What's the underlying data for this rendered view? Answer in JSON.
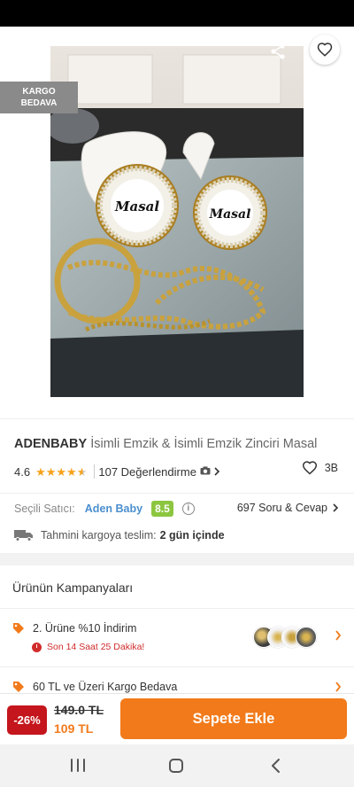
{
  "header": {
    "back_icon": "arrow-left-icon",
    "share_icon": "share-icon",
    "favorite_icon": "heart-outline-icon"
  },
  "badge": {
    "line1": "KARGO",
    "line2": "BEDAVA"
  },
  "product": {
    "image_text_left": "Masal",
    "image_text_right": "Masal",
    "brand": "ADENBABY",
    "name": "İsimli Emzik & İsimli Emzik Zinciri Masal",
    "rating": "4.6",
    "stars": 4.6,
    "review_count": "107 Değerlendirme",
    "camera_icon": "camera-icon",
    "likes": "3B"
  },
  "seller": {
    "label": "Seçili Satıcı:",
    "name": "Aden Baby",
    "score": "8.5",
    "qa_label": "697 Soru & Cevap"
  },
  "delivery": {
    "icon": "truck-icon",
    "label": "Tahmini kargoya teslim:",
    "value": "2 gün içinde"
  },
  "campaigns": {
    "title": "Ürünün Kampanyaları",
    "items": [
      {
        "label": "2. Ürüne %10 İndirim",
        "countdown": "Son 14 Saat 25 Dakika!"
      },
      {
        "label": "60 TL ve Üzeri Kargo Bedava"
      }
    ]
  },
  "purchase": {
    "discount": "-26%",
    "old_price": "149.0 TL",
    "new_price": "109 TL",
    "button_label": "Sepete Ekle"
  },
  "colors": {
    "accent": "#f27a1a",
    "discount_red": "#c4161c",
    "seller_blue": "#4a8fcf",
    "score_green": "#8cc63f",
    "star": "#f7a21b"
  }
}
